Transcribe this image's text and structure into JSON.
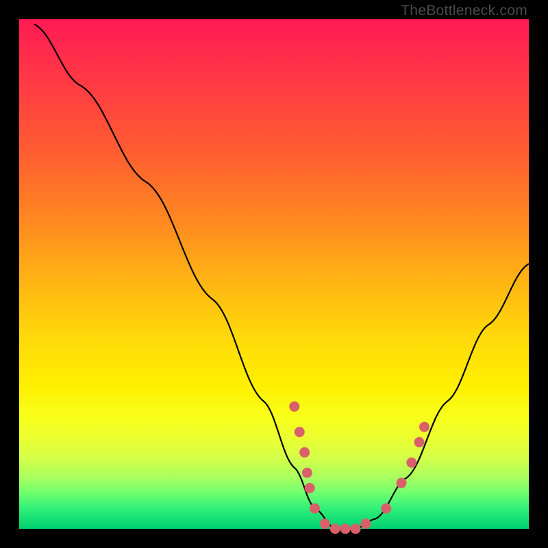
{
  "watermark": "TheBottleneck.com",
  "chart_data": {
    "type": "line",
    "title": "",
    "xlabel": "",
    "ylabel": "",
    "xlim": [
      0,
      100
    ],
    "ylim": [
      0,
      100
    ],
    "series": [
      {
        "name": "bottleneck-curve",
        "points": [
          {
            "x": 3,
            "y": 99
          },
          {
            "x": 12,
            "y": 87
          },
          {
            "x": 25,
            "y": 68
          },
          {
            "x": 38,
            "y": 45
          },
          {
            "x": 48,
            "y": 25
          },
          {
            "x": 54,
            "y": 12
          },
          {
            "x": 58,
            "y": 4
          },
          {
            "x": 62,
            "y": 0
          },
          {
            "x": 66,
            "y": 0
          },
          {
            "x": 70,
            "y": 2
          },
          {
            "x": 76,
            "y": 10
          },
          {
            "x": 84,
            "y": 25
          },
          {
            "x": 92,
            "y": 40
          },
          {
            "x": 100,
            "y": 52
          }
        ]
      }
    ],
    "marker_cluster": [
      {
        "x": 54,
        "y": 24
      },
      {
        "x": 55,
        "y": 19
      },
      {
        "x": 56,
        "y": 15
      },
      {
        "x": 56.5,
        "y": 11
      },
      {
        "x": 57,
        "y": 8
      },
      {
        "x": 58,
        "y": 4
      },
      {
        "x": 60,
        "y": 1
      },
      {
        "x": 62,
        "y": 0
      },
      {
        "x": 64,
        "y": 0
      },
      {
        "x": 66,
        "y": 0
      },
      {
        "x": 68,
        "y": 1
      },
      {
        "x": 72,
        "y": 4
      },
      {
        "x": 75,
        "y": 9
      },
      {
        "x": 77,
        "y": 13
      },
      {
        "x": 78.5,
        "y": 17
      },
      {
        "x": 79.5,
        "y": 20
      }
    ],
    "colors": {
      "curve": "#000000",
      "markers": "#d9606a",
      "gradient_top": "#ff1a53",
      "gradient_mid": "#ffd80a",
      "gradient_bottom": "#00d070"
    }
  }
}
